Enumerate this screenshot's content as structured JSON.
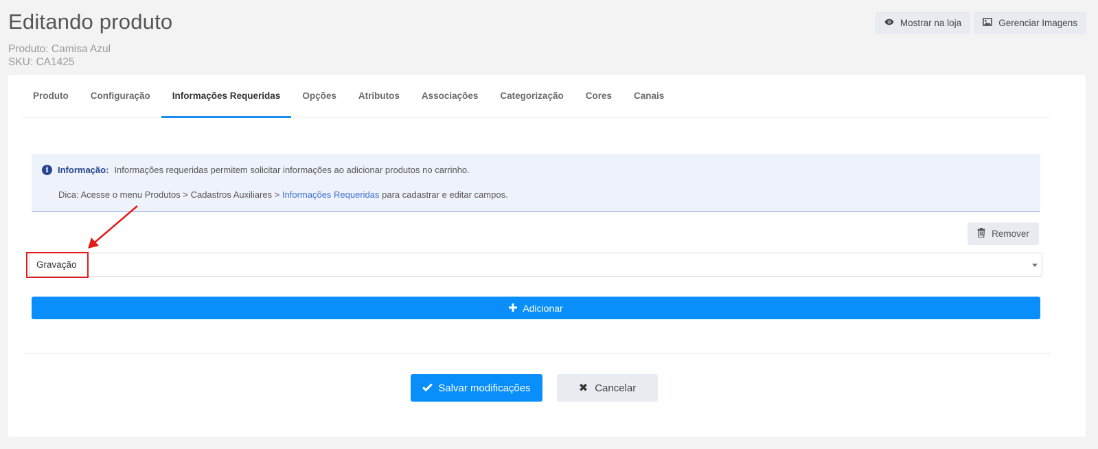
{
  "header": {
    "title": "Editando produto",
    "product_line": "Produto: Camisa Azul",
    "sku_line": "SKU: CA1425",
    "actions": [
      {
        "label": "Mostrar na loja",
        "icon": "eye-icon"
      },
      {
        "label": "Gerenciar Imagens",
        "icon": "image-icon"
      }
    ]
  },
  "tabs": [
    {
      "label": "Produto"
    },
    {
      "label": "Configuração"
    },
    {
      "label": "Informações Requeridas",
      "active": true
    },
    {
      "label": "Opções"
    },
    {
      "label": "Atributos"
    },
    {
      "label": "Associações"
    },
    {
      "label": "Categorização"
    },
    {
      "label": "Cores"
    },
    {
      "label": "Canais"
    }
  ],
  "info": {
    "label": "Informação:",
    "text": "Informações requeridas permitem solicitar informações ao adicionar produtos no carrinho.",
    "tip_prefix": "Dica: Acesse o menu Produtos > Cadastros Auxiliares > ",
    "tip_link": "Informações Requeridas",
    "tip_suffix": " para cadastrar e editar campos."
  },
  "required_field": {
    "remove_label": "Remover",
    "selected_value": "Gravação"
  },
  "add_label": "Adicionar",
  "footer": {
    "save_label": "Salvar modificações",
    "cancel_label": "Cancelar"
  },
  "colors": {
    "primary": "#0a8ffa",
    "annotation": "#e21b1b",
    "info_accent": "#26448f"
  }
}
